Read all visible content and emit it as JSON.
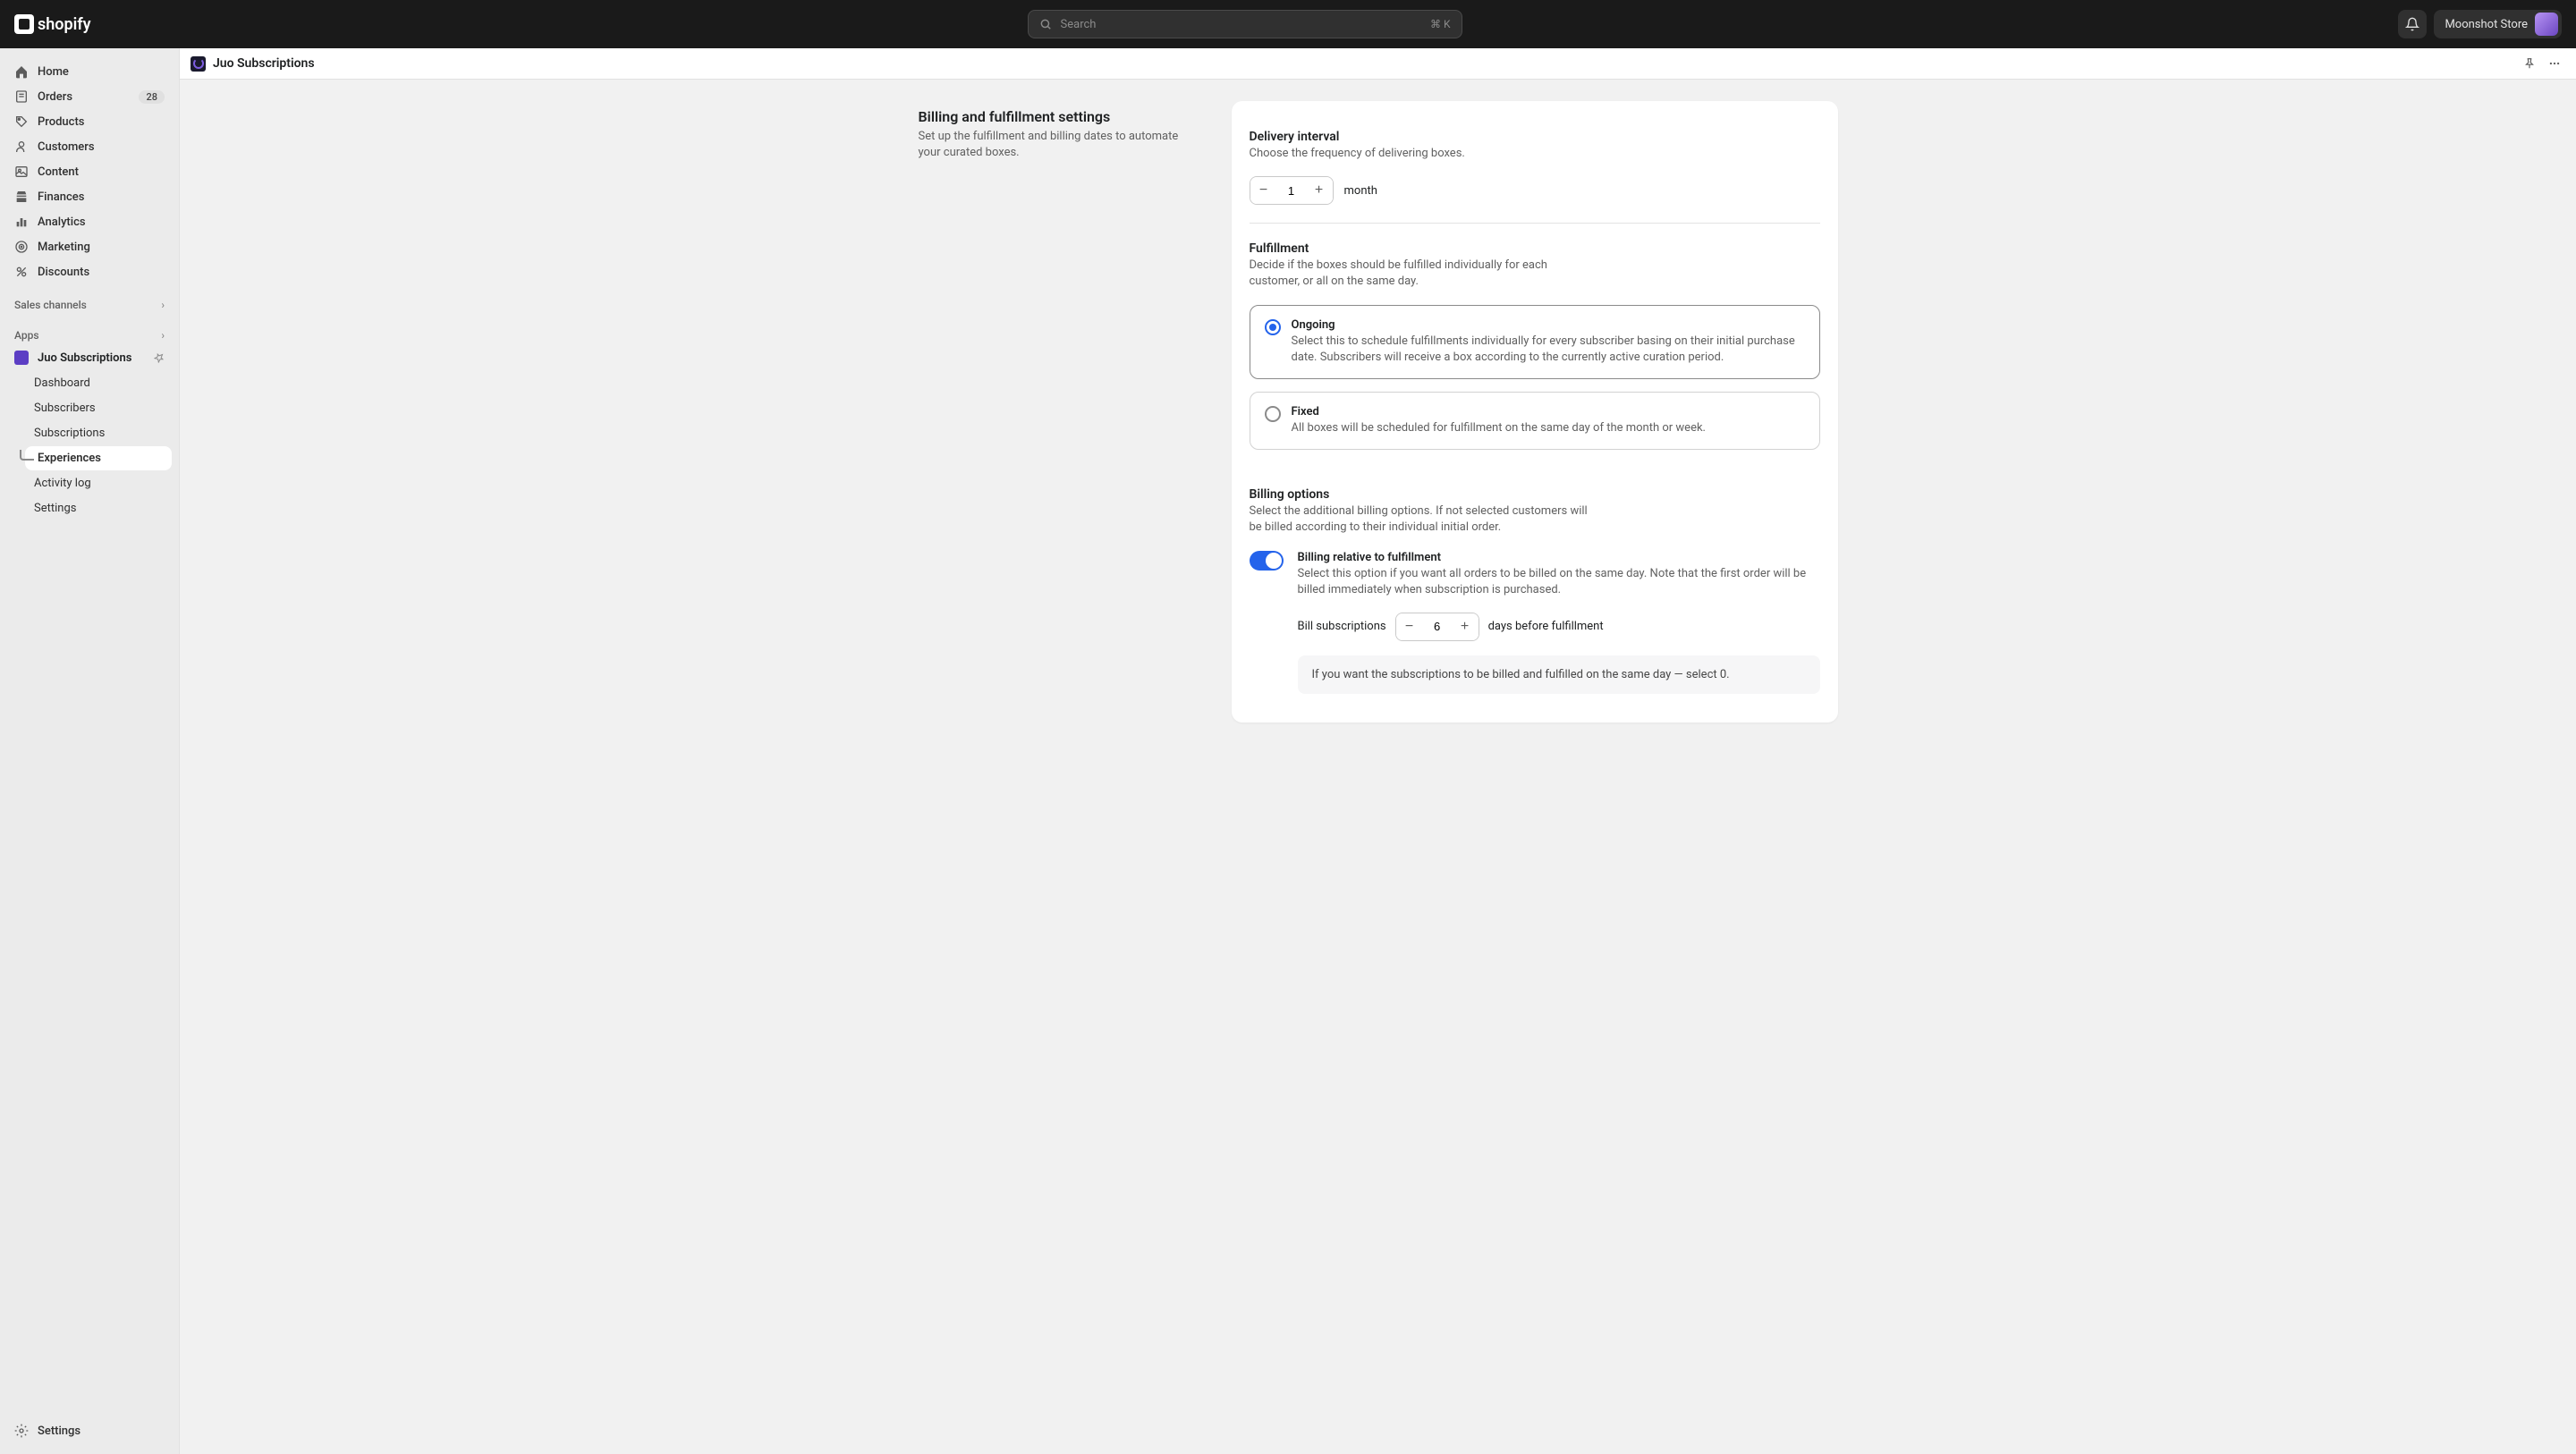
{
  "header": {
    "brand": "shopify",
    "search_placeholder": "Search",
    "search_shortcut": "⌘ K",
    "store_name": "Moonshot Store"
  },
  "sidebar": {
    "items": [
      {
        "label": "Home",
        "icon": "home"
      },
      {
        "label": "Orders",
        "icon": "orders",
        "badge": "28"
      },
      {
        "label": "Products",
        "icon": "products"
      },
      {
        "label": "Customers",
        "icon": "customers"
      },
      {
        "label": "Content",
        "icon": "content"
      },
      {
        "label": "Finances",
        "icon": "finances"
      },
      {
        "label": "Analytics",
        "icon": "analytics"
      },
      {
        "label": "Marketing",
        "icon": "marketing"
      },
      {
        "label": "Discounts",
        "icon": "discounts"
      }
    ],
    "sections": {
      "sales": "Sales channels",
      "apps": "Apps"
    },
    "app": {
      "name": "Juo Subscriptions",
      "sub_items": [
        {
          "label": "Dashboard"
        },
        {
          "label": "Subscribers"
        },
        {
          "label": "Subscriptions"
        },
        {
          "label": "Experiences",
          "active": true
        },
        {
          "label": "Activity log"
        },
        {
          "label": "Settings"
        }
      ]
    },
    "footer_settings": "Settings"
  },
  "page": {
    "app_title": "Juo Subscriptions",
    "left_heading": "Billing and fulfillment settings",
    "left_desc": "Set up the fulfillment and billing dates to automate your curated boxes."
  },
  "delivery": {
    "title": "Delivery interval",
    "desc": "Choose the frequency of delivering boxes.",
    "value": "1",
    "unit": "month"
  },
  "fulfillment": {
    "title": "Fulfillment",
    "desc": "Decide if the boxes should be fulfilled individually for each customer, or all on the same day.",
    "options": [
      {
        "label": "Ongoing",
        "desc": "Select this to schedule fulfillments individually for every subscriber basing on their initial purchase date. Subscribers will receive a box according to the currently active curation period.",
        "selected": true
      },
      {
        "label": "Fixed",
        "desc": "All boxes will be scheduled for fulfillment on the same day of the month or week.",
        "selected": false
      }
    ]
  },
  "billing": {
    "title": "Billing options",
    "desc": "Select the additional billing options. If not selected customers will be billed according to their individual initial order.",
    "toggle_title": "Billing relative to fulfillment",
    "toggle_desc": "Select this option if you want all orders to be billed on the same day. Note that the first order will be billed immediately when subscription is purchased.",
    "bill_prefix": "Bill subscriptions",
    "bill_value": "6",
    "bill_suffix": "days before fulfillment",
    "info": "If you want the subscriptions to be billed and fulfilled on the same day — select 0."
  }
}
